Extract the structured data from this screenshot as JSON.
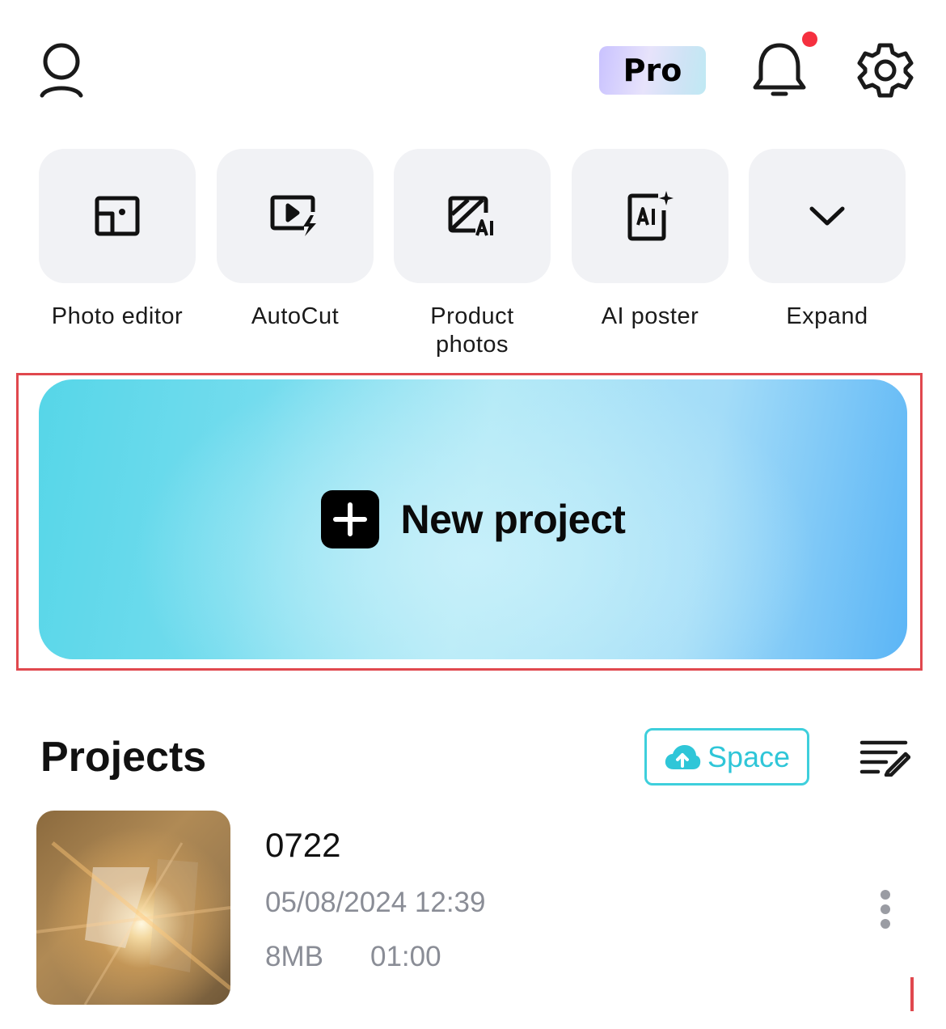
{
  "header": {
    "pro_badge": "Pro",
    "has_notification": true,
    "icons": [
      "profile-icon",
      "bell-icon",
      "gear-icon"
    ]
  },
  "tools": [
    {
      "label": "Photo editor",
      "icon": "photo-editor-icon"
    },
    {
      "label": "AutoCut",
      "icon": "autocut-icon"
    },
    {
      "label": "Product photos",
      "icon": "product-photos-icon"
    },
    {
      "label": "AI poster",
      "icon": "ai-poster-icon"
    },
    {
      "label": "Expand",
      "icon": "chevron-down-icon"
    }
  ],
  "new_project": {
    "label": "New project",
    "icon": "plus-icon"
  },
  "projects": {
    "title": "Projects",
    "space_label": "Space",
    "items": [
      {
        "name": "0722",
        "date": "05/08/2024 12:39",
        "size": "8MB",
        "duration": "01:00"
      }
    ]
  },
  "colors": {
    "accent_cyan": "#2fc6d8",
    "notification_dot": "#f5303f",
    "highlight_border": "#e0484e",
    "tile_bg": "#f1f2f5",
    "meta_text": "#8a8d96"
  }
}
